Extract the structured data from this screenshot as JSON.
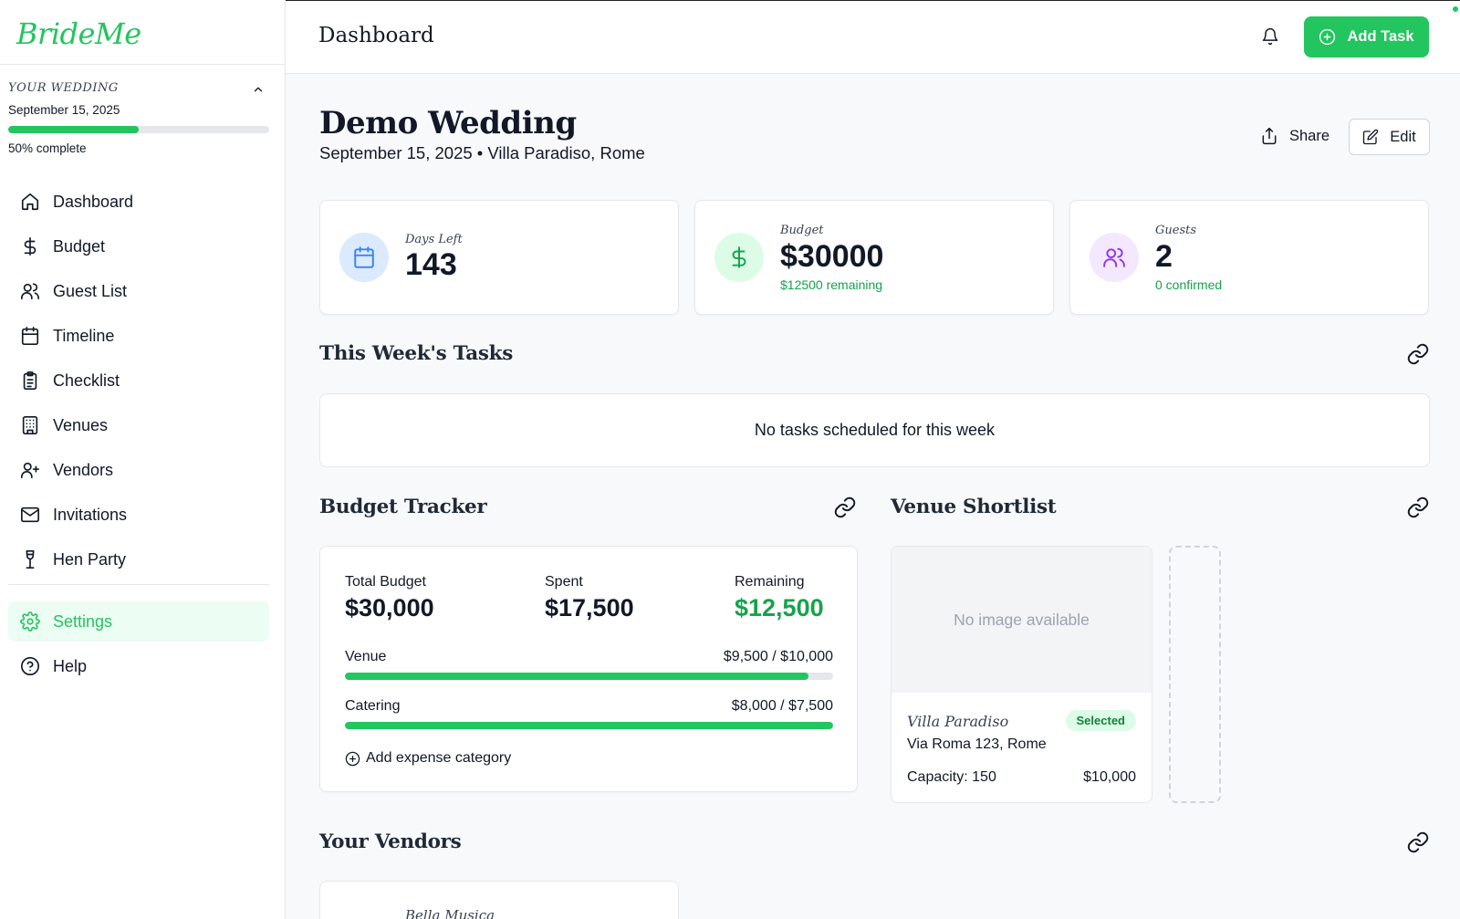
{
  "brand": "BrideMe",
  "sidebar": {
    "wedding_label": "YOUR WEDDING",
    "wedding_date": "September 15, 2025",
    "progress": 0.5,
    "progress_text": "50% complete",
    "items": [
      {
        "label": "Dashboard",
        "icon": "home-icon"
      },
      {
        "label": "Budget",
        "icon": "dollar-icon"
      },
      {
        "label": "Guest List",
        "icon": "users-icon"
      },
      {
        "label": "Timeline",
        "icon": "calendar-icon"
      },
      {
        "label": "Checklist",
        "icon": "clipboard-icon"
      },
      {
        "label": "Venues",
        "icon": "building-icon"
      },
      {
        "label": "Vendors",
        "icon": "user-plus-icon"
      },
      {
        "label": "Invitations",
        "icon": "mail-icon"
      },
      {
        "label": "Hen Party",
        "icon": "wine-glass-icon"
      }
    ],
    "settings_label": "Settings",
    "help_label": "Help"
  },
  "topbar": {
    "title": "Dashboard",
    "add_task_label": "Add Task"
  },
  "wedding": {
    "title": "Demo Wedding",
    "subtitle": "September 15, 2025 • Villa Paradiso, Rome",
    "share_label": "Share",
    "edit_label": "Edit"
  },
  "stats": {
    "days": {
      "label": "Days Left",
      "value": "143"
    },
    "budget": {
      "label": "Budget",
      "value": "$30000",
      "sub": "$12500 remaining"
    },
    "guests": {
      "label": "Guests",
      "value": "2",
      "sub": "0 confirmed"
    }
  },
  "tasks": {
    "title": "This Week's Tasks",
    "empty": "No tasks scheduled for this week"
  },
  "budget_tracker": {
    "title": "Budget Tracker",
    "total_label": "Total Budget",
    "total_value": "$30,000",
    "spent_label": "Spent",
    "spent_value": "$17,500",
    "remaining_label": "Remaining",
    "remaining_value": "$12,500",
    "categories": [
      {
        "name": "Venue",
        "amount": "$9,500 / $10,000",
        "fraction": 0.95
      },
      {
        "name": "Catering",
        "amount": "$8,000 / $7,500",
        "fraction": 1.0
      }
    ],
    "add_label": "Add expense category"
  },
  "venues": {
    "title": "Venue Shortlist",
    "no_image": "No image available",
    "name": "Villa Paradiso",
    "badge": "Selected",
    "address": "Via Roma 123, Rome",
    "capacity": "Capacity: 150",
    "price": "$10,000"
  },
  "vendors": {
    "title": "Your Vendors",
    "first_name": "Bella Musica"
  },
  "colors": {
    "accent": "#22c55e",
    "accent_dark": "#16a34a",
    "days_circle": "#dbeafe",
    "budget_circle": "#dcfce7",
    "guests_circle": "#f3e8ff"
  }
}
